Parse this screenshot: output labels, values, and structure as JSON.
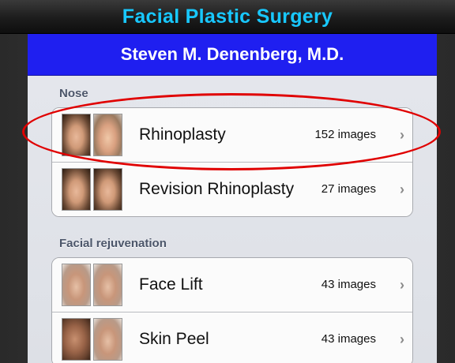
{
  "app": {
    "title": "Facial Plastic Surgery"
  },
  "header": {
    "doctor": "Steven M. Denenberg, M.D."
  },
  "sections": [
    {
      "label": "Nose",
      "items": [
        {
          "label": "Rhinoplasty",
          "count": "152 images",
          "chevron": "›"
        },
        {
          "label": "Revision Rhinoplasty",
          "count": "27 images",
          "chevron": "›"
        }
      ]
    },
    {
      "label": "Facial rejuvenation",
      "items": [
        {
          "label": "Face Lift",
          "count": "43 images",
          "chevron": "›"
        },
        {
          "label": "Skin Peel",
          "count": "43 images",
          "chevron": "›"
        }
      ]
    }
  ],
  "colors": {
    "title": "#18c8ff",
    "header_bg": "#1f1ff0",
    "highlight": "#e00000"
  },
  "icons": {
    "chevron": "chevron-right-icon"
  }
}
